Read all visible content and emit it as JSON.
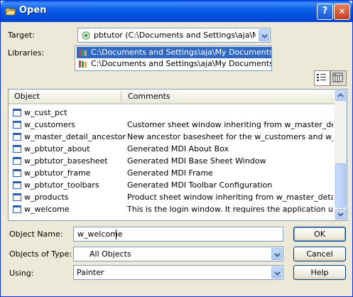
{
  "window": {
    "title": "Open",
    "help_glyph": "?",
    "close_glyph": "✕"
  },
  "target": {
    "label": "Target:",
    "value": "pbtutor (C:\\Documents and Settings\\aja\\My Doc"
  },
  "libraries": {
    "label": "Libraries:",
    "items": [
      {
        "text": "C:\\Documents and Settings\\aja\\My Documents\\Syba",
        "selected": true
      },
      {
        "text": "C:\\Documents and Settings\\aja\\My Documents\\Syba",
        "selected": false
      }
    ]
  },
  "view_buttons": {
    "list_icon": "list-view-icon",
    "details_icon": "details-view-icon"
  },
  "object_list": {
    "columns": [
      "Object",
      "Comments"
    ],
    "rows": [
      {
        "name": "w_cust_pct",
        "comment": ""
      },
      {
        "name": "w_customers",
        "comment": "Customer sheet window inheriting from w_master_detail..."
      },
      {
        "name": "w_master_detail_ancestor",
        "comment": "New ancestor basesheet for the w_customers and w_pr..."
      },
      {
        "name": "w_pbtutor_about",
        "comment": "Generated MDI About Box"
      },
      {
        "name": "w_pbtutor_basesheet",
        "comment": "Generated MDI Base Sheet Window"
      },
      {
        "name": "w_pbtutor_frame",
        "comment": "Generated MDI Frame"
      },
      {
        "name": "w_pbtutor_toolbars",
        "comment": "Generated MDI Toolbar Configuration"
      },
      {
        "name": "w_products",
        "comment": "Product sheet window inheriting from w_master_detail_..."
      },
      {
        "name": "w_welcome",
        "comment": "This is the login window. It requires the application user ..."
      }
    ]
  },
  "object_name": {
    "label": "Object Name:",
    "value": "w_welcome"
  },
  "objects_of_type": {
    "label": "Objects of Type:",
    "value": "All Objects"
  },
  "using": {
    "label": "Using:",
    "value": "Painter"
  },
  "buttons": {
    "ok": "OK",
    "cancel": "Cancel",
    "help": "Help"
  },
  "colors": {
    "selection": "#316ac5",
    "titlebar": "#0a5fe8",
    "face": "#ece9d8"
  }
}
